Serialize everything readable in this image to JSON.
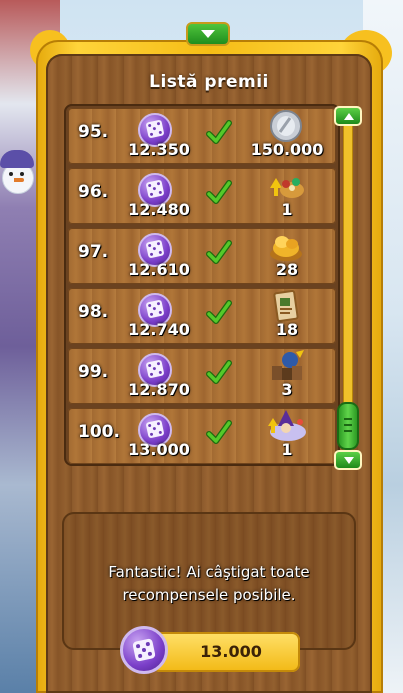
{
  "panel": {
    "title": "Listă premii"
  },
  "rewards": [
    {
      "rank": "95.",
      "cost": "12.350",
      "claimed": true,
      "reward_icon": "silver-coin-icon",
      "reward_qty": "150.000"
    },
    {
      "rank": "96.",
      "cost": "12.480",
      "claimed": true,
      "reward_icon": "upgrade-item-icon",
      "reward_qty": "1"
    },
    {
      "rank": "97.",
      "cost": "12.610",
      "claimed": true,
      "reward_icon": "gold-pile-icon",
      "reward_qty": "28"
    },
    {
      "rank": "98.",
      "cost": "12.740",
      "claimed": true,
      "reward_icon": "scroll-card-icon",
      "reward_qty": "18"
    },
    {
      "rank": "99.",
      "cost": "12.870",
      "claimed": true,
      "reward_icon": "warrior-troop-icon",
      "reward_qty": "3"
    },
    {
      "rank": "100.",
      "cost": "13.000",
      "claimed": true,
      "reward_icon": "wizard-upgrade-icon",
      "reward_qty": "1"
    }
  ],
  "message": {
    "line1": "Fantastic! Ai câştigat toate",
    "line2": "recompensele posibile."
  },
  "balance": {
    "value": "13.000",
    "icon": "ticket-coin-icon"
  },
  "colors": {
    "frame_gold": "#f5bd16",
    "wood": "#9a6533",
    "button_green": "#2c9a24",
    "check_green": "#3fb51f",
    "ticket_purple": "#7b3fc9"
  }
}
